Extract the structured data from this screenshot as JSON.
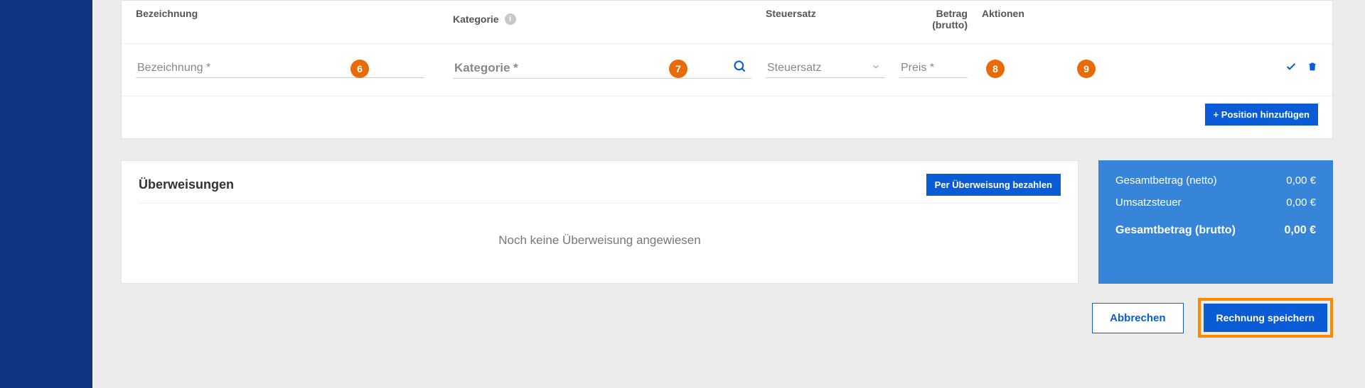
{
  "columns": {
    "bezeichnung": "Bezeichnung",
    "kategorie": "Kategorie",
    "steuersatz": "Steuersatz",
    "betrag": "Betrag (brutto)",
    "aktionen": "Aktionen"
  },
  "row": {
    "bez_placeholder": "Bezeichnung *",
    "kat_placeholder": "Kategorie *",
    "tax_placeholder": "Steuersatz",
    "price_placeholder": "Preis *"
  },
  "badges": {
    "b6": "6",
    "b7": "7",
    "b8": "8",
    "b9": "9"
  },
  "buttons": {
    "add_position": "+  Position hinzufügen",
    "pay_transfer": "Per Überweisung bezahlen",
    "cancel": "Abbrechen",
    "save": "Rechnung speichern"
  },
  "transfers": {
    "title": "Überweisungen",
    "empty": "Noch keine Überweisung angewiesen"
  },
  "totals": {
    "net_label": "Gesamtbetrag (netto)",
    "net_value": "0,00 €",
    "vat_label": "Umsatzsteuer",
    "vat_value": "0,00 €",
    "gross_label": "Gesamtbetrag (brutto)",
    "gross_value": "0,00 €"
  }
}
